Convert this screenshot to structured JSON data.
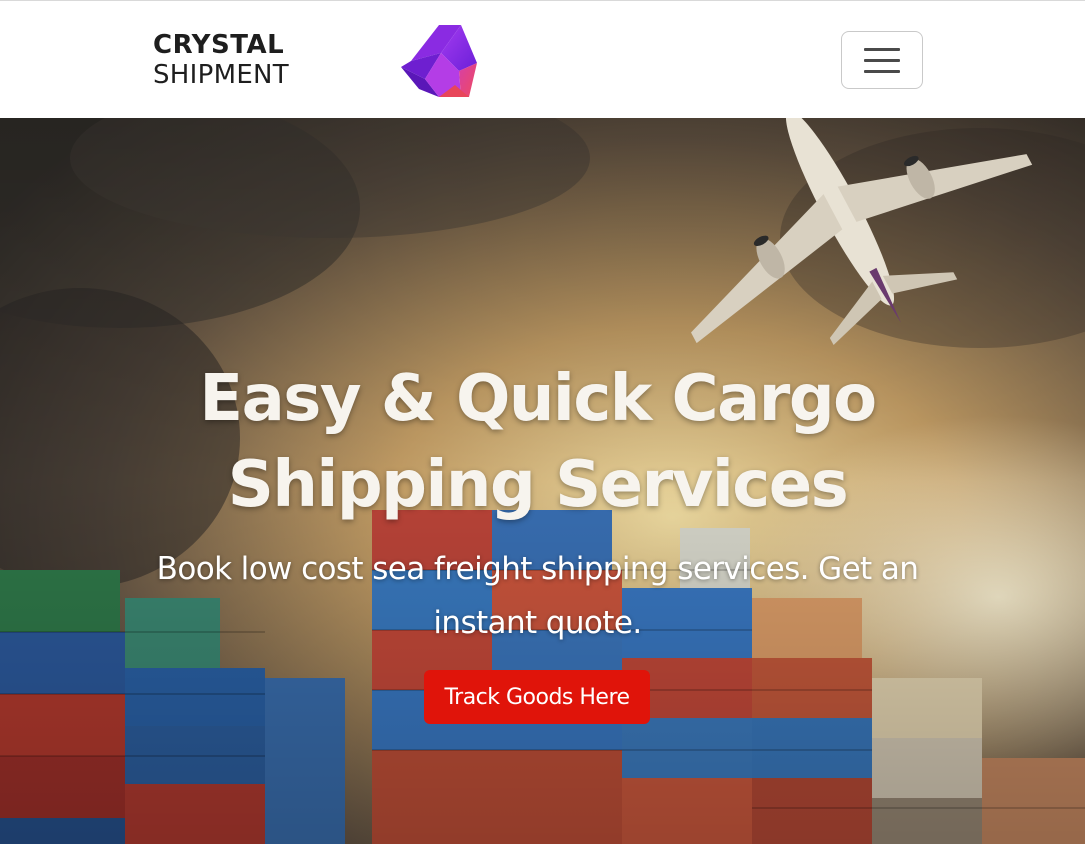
{
  "navbar": {
    "brand_line1": "CRYSTAL",
    "brand_line2": "SHIPMENT",
    "logo_icon": "crystal-logo-icon",
    "menu_icon": "hamburger-menu-icon"
  },
  "hero": {
    "title": "Easy & Quick Cargo Shipping Services",
    "subtitle": "Book low cost sea freight shipping services. Get an instant quote.",
    "cta_label": "Track Goods Here",
    "background": "airplane-over-shipping-containers-photo"
  },
  "colors": {
    "cta_red": "#e0140a",
    "logo_purple": "#7b2ff7",
    "logo_magenta": "#c026d3",
    "logo_coral": "#f0406a",
    "nav_background": "#ffffff",
    "hero_text": "#ffffff"
  }
}
